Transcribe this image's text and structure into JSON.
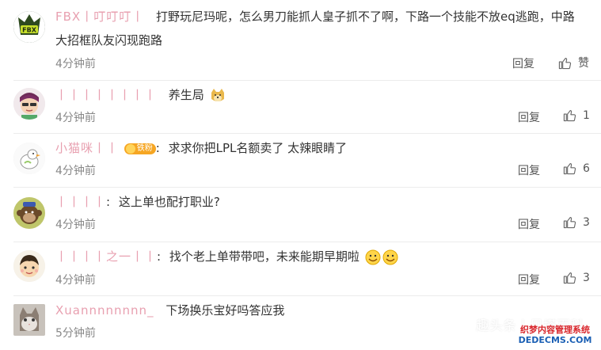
{
  "comments": [
    {
      "username": "FBX丨叮叮叮丨",
      "text_line1": "打野玩尼玛呢，怎么男刀能抓人皇子抓不了啊，下路一个技能不放eq逃跑，中路",
      "text_line2": "大招框队友闪现跑路",
      "time": "4分钟前",
      "reply_label": "回复",
      "like_label": "赞",
      "avatar_icon": "fbx-logo-avatar-icon"
    },
    {
      "username": "丨丨丨丨丨丨丨丨",
      "text_line1": "养生局",
      "time": "4分钟前",
      "reply_label": "回复",
      "like_count": "1",
      "avatar_icon": "cartoon-face-avatar-icon"
    },
    {
      "username": "小猫咪丨丨",
      "badge": "铁粉",
      "text_line1": "求求你把LPL名额卖了 太辣眼睛了",
      "time": "4分钟前",
      "reply_label": "回复",
      "like_count": "6",
      "avatar_icon": "duck-avatar-icon"
    },
    {
      "username": "丨丨丨丨",
      "text_line1": "这上单也配打职业?",
      "time": "4分钟前",
      "reply_label": "回复",
      "like_count": "3",
      "avatar_icon": "monkey-avatar-icon"
    },
    {
      "username": "丨丨丨丨之一丨丨",
      "text_line1": "找个老上单带带吧，未来能期早期啦",
      "time": "4分钟前",
      "reply_label": "回复",
      "like_count": "3",
      "avatar_icon": "boy-avatar-icon"
    },
    {
      "username": "Xuannnnnnnn_",
      "text_line1": "下场换乐宝好吗答应我",
      "time": "5分钟前",
      "avatar_icon": "cat-avatar-icon"
    }
  ],
  "watermark": {
    "text": "趣头条丨贝塔百科",
    "logo_top": "织梦内容管理系统",
    "logo_bottom": "DEDECMS.COM"
  },
  "colors": {
    "username": "#e8a0b0",
    "time": "#888888",
    "badge": "#f6a623"
  }
}
